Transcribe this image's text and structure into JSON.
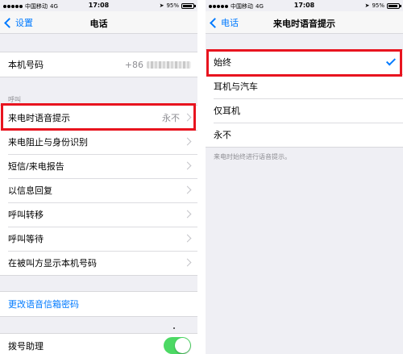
{
  "status": {
    "carrier": "中国移动",
    "network": "4G",
    "time": "17:08",
    "battery_text": "95%",
    "battery_level": 0.95
  },
  "left": {
    "back_label": "设置",
    "title": "电话",
    "my_number_label": "本机号码",
    "my_number_value": "+86",
    "calls_section": "呼叫",
    "rows": [
      {
        "label": "来电时语音提示",
        "value": "永不"
      },
      {
        "label": "来电阻止与身份识别"
      },
      {
        "label": "短信/来电报告"
      },
      {
        "label": "以信息回复"
      },
      {
        "label": "呼叫转移"
      },
      {
        "label": "呼叫等待"
      },
      {
        "label": "在被叫方显示本机号码"
      }
    ],
    "voicemail_link": "更改语音信箱密码",
    "dial_assist_label": "拨号助理",
    "dial_assist_on": true
  },
  "right": {
    "back_label": "电话",
    "title": "来电时语音提示",
    "options": [
      {
        "label": "始终",
        "selected": true
      },
      {
        "label": "耳机与汽车",
        "selected": false
      },
      {
        "label": "仅耳机",
        "selected": false
      },
      {
        "label": "永不",
        "selected": false
      }
    ],
    "footer": "来电时始终进行语音提示。"
  },
  "colors": {
    "accent": "#007aff",
    "highlight": "#e8141f",
    "toggle_on": "#4cd964"
  }
}
